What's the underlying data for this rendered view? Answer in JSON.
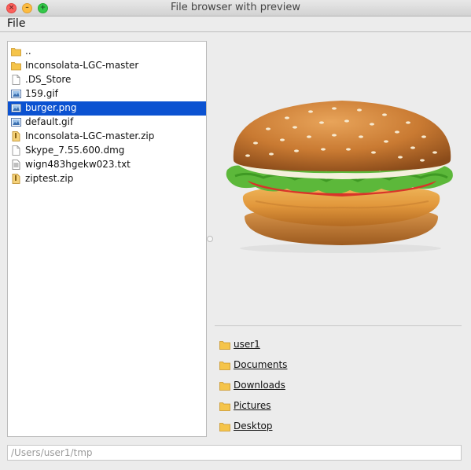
{
  "window": {
    "title": "File browser with preview"
  },
  "menubar": {
    "items": [
      {
        "label": "File"
      }
    ]
  },
  "file_list": {
    "items": [
      {
        "name": "..",
        "type": "folder"
      },
      {
        "name": "Inconsolata-LGC-master",
        "type": "folder"
      },
      {
        "name": ".DS_Store",
        "type": "file"
      },
      {
        "name": "159.gif",
        "type": "image"
      },
      {
        "name": "burger.png",
        "type": "image",
        "selected": true
      },
      {
        "name": "default.gif",
        "type": "image"
      },
      {
        "name": "Inconsolata-LGC-master.zip",
        "type": "archive"
      },
      {
        "name": "Skype_7.55.600.dmg",
        "type": "file"
      },
      {
        "name": "wign483hgekw023.txt",
        "type": "text"
      },
      {
        "name": "ziptest.zip",
        "type": "archive"
      }
    ],
    "selection_color": "#0b52d1"
  },
  "preview": {
    "image": "burger"
  },
  "favorites": {
    "items": [
      {
        "name": "user1"
      },
      {
        "name": "Documents"
      },
      {
        "name": "Downloads"
      },
      {
        "name": "Pictures"
      },
      {
        "name": "Desktop"
      }
    ]
  },
  "path_field": {
    "placeholder": "/Users/user1/tmp"
  }
}
